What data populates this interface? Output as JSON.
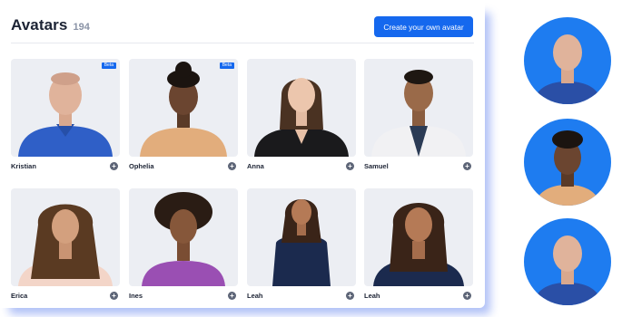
{
  "header": {
    "title": "Avatars",
    "count": "194",
    "create_button_label": "Create your own avatar"
  },
  "avatars": [
    {
      "name": "Kristian",
      "badge": "Beta"
    },
    {
      "name": "Ophelia",
      "badge": "Beta"
    },
    {
      "name": "Anna",
      "badge": ""
    },
    {
      "name": "Samuel",
      "badge": ""
    },
    {
      "name": "Erica",
      "badge": ""
    },
    {
      "name": "Ines",
      "badge": ""
    },
    {
      "name": "Leah",
      "badge": ""
    },
    {
      "name": "Leah",
      "badge": ""
    }
  ],
  "colors": {
    "accent": "#1568ee",
    "circle_background": "#1e7cf0"
  }
}
